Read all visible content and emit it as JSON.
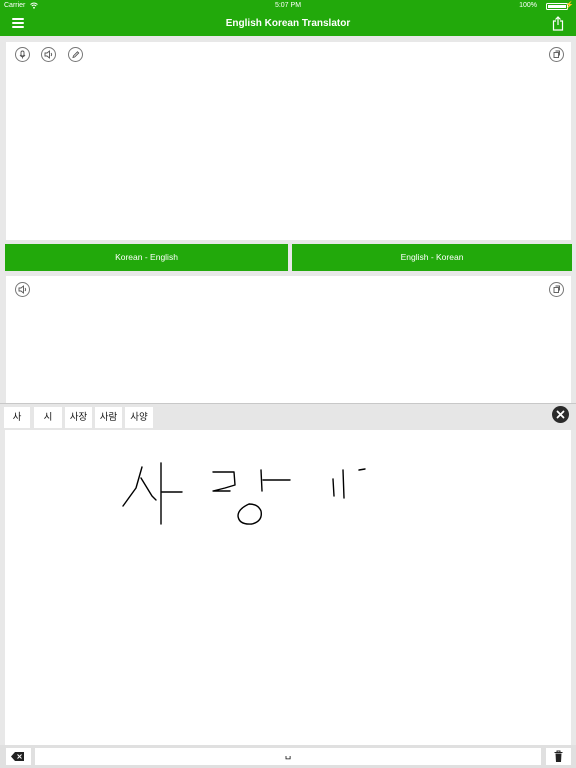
{
  "status_bar": {
    "carrier": "Carrier",
    "time": "5:07 PM",
    "battery_percent": "100%",
    "battery_level": 1.0
  },
  "nav": {
    "title": "English Korean Translator",
    "menu_icon": "hamburger-menu-icon",
    "share_icon": "share-icon",
    "color": "#22a90b"
  },
  "input_panel": {
    "icons": [
      "microphone-icon",
      "speaker-icon",
      "pencil-icon",
      "copy-icon"
    ]
  },
  "direction_buttons": {
    "left_label": "Korean - English",
    "right_label": "English - Korean"
  },
  "output_panel": {
    "icons": [
      "speaker-icon",
      "copy-icon"
    ]
  },
  "handwriting": {
    "candidates": [
      "사",
      "시",
      "사장",
      "사람",
      "사양"
    ],
    "close_icon": "close-circle-icon",
    "space_key_label": "␣",
    "backspace_icon": "backspace-icon",
    "trash_icon": "trash-icon"
  }
}
